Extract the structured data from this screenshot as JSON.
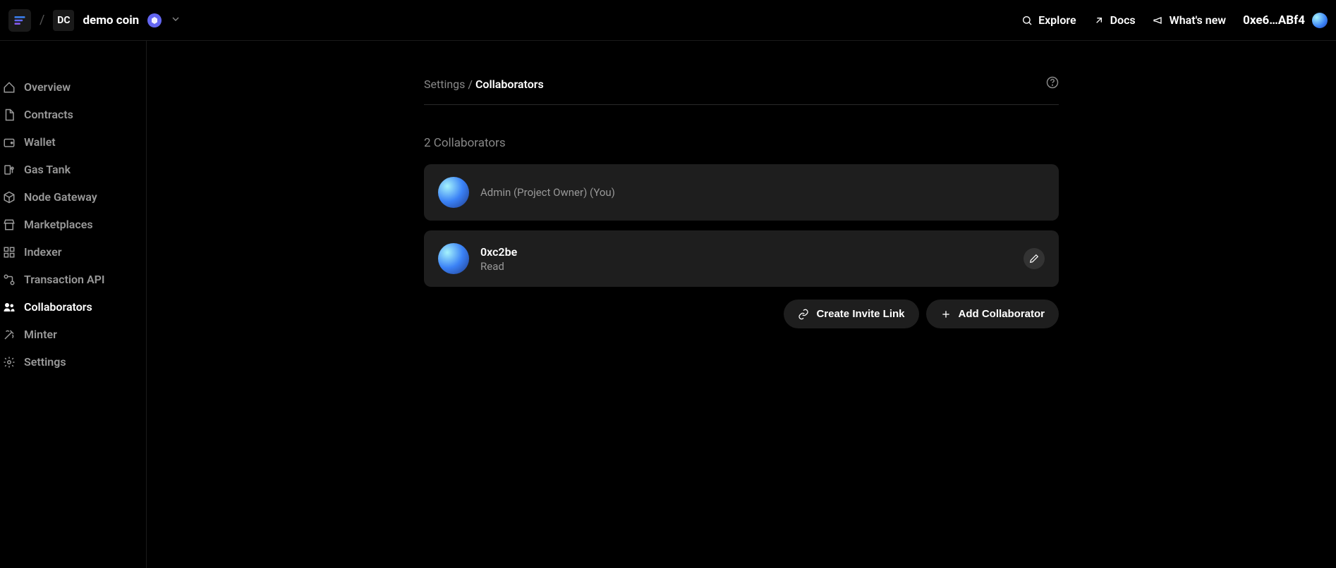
{
  "header": {
    "project_abbr": "DC",
    "project_name": "demo coin",
    "links": {
      "explore": "Explore",
      "docs": "Docs",
      "whats_new": "What's new"
    },
    "user_address": "0xe6…ABf4"
  },
  "sidebar": {
    "items": [
      {
        "label": "Overview",
        "icon": "home"
      },
      {
        "label": "Contracts",
        "icon": "document"
      },
      {
        "label": "Wallet",
        "icon": "wallet"
      },
      {
        "label": "Gas Tank",
        "icon": "gas"
      },
      {
        "label": "Node Gateway",
        "icon": "cube"
      },
      {
        "label": "Marketplaces",
        "icon": "store"
      },
      {
        "label": "Indexer",
        "icon": "grid"
      },
      {
        "label": "Transaction API",
        "icon": "route"
      },
      {
        "label": "Collaborators",
        "icon": "users",
        "active": true
      },
      {
        "label": "Minter",
        "icon": "pickaxe"
      },
      {
        "label": "Settings",
        "icon": "gear"
      }
    ]
  },
  "breadcrumb": {
    "parent": "Settings",
    "separator": " / ",
    "current": "Collaborators"
  },
  "collab": {
    "count_label": "2 Collaborators",
    "list": [
      {
        "name": "",
        "role": "Admin (Project Owner) (You)",
        "editable": false
      },
      {
        "name": "0xc2be",
        "role": "Read",
        "editable": true
      }
    ],
    "create_link_label": "Create Invite Link",
    "add_label": "Add Collaborator"
  }
}
